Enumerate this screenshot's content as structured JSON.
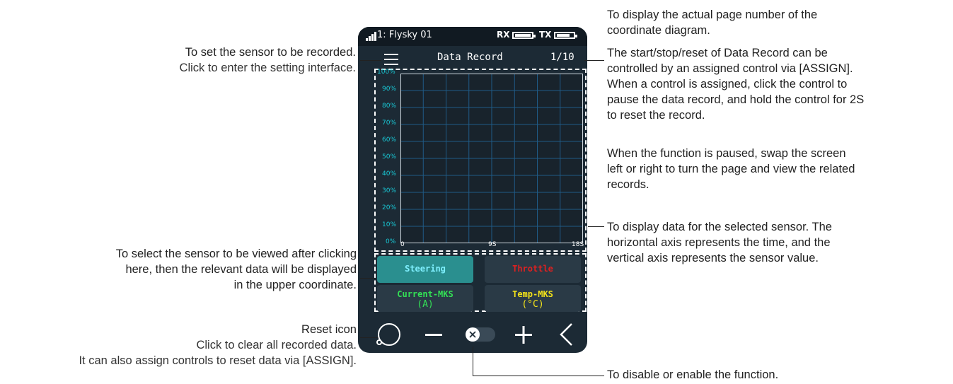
{
  "status_bar": {
    "model": "1: Flysky  01",
    "rx_label": "RX",
    "tx_label": "TX"
  },
  "screen": {
    "title": "Data Record",
    "page_indicator": "1/10"
  },
  "chart_data": {
    "type": "line",
    "y_ticks": [
      "100%",
      "90%",
      "80%",
      "70%",
      "60%",
      "50%",
      "40%",
      "30%",
      "20%",
      "10%",
      "0%"
    ],
    "x_ticks": [
      "0",
      "9S",
      "18S"
    ],
    "series": [],
    "grid": true
  },
  "sensors": [
    {
      "label": "Steering",
      "unit": "",
      "color": "#2ad0ff",
      "selected": true
    },
    {
      "label": "Throttle",
      "unit": "",
      "color": "#e02020",
      "selected": false
    },
    {
      "label": "Current-MKS",
      "unit": "(A)",
      "color": "#33e055",
      "selected": false
    },
    {
      "label": "Temp-MKS",
      "unit": "(°C)",
      "color": "#f2e21a",
      "selected": false
    }
  ],
  "toolbar": {
    "icons": [
      "reset-icon",
      "minus-icon",
      "toggle-switch",
      "plus-icon",
      "back-icon"
    ],
    "toggle_state": "off"
  },
  "annotations": {
    "page_number": [
      "To display the actual page number of the",
      "coordinate diagram."
    ],
    "assign": [
      "The start/stop/reset of Data Record can be",
      "controlled by an assigned control via [ASSIGN].",
      "When a control is assigned, click the control to",
      "pause the data record, and hold the control for 2S",
      "to reset the record."
    ],
    "paused": [
      "When the function is paused, swap the screen",
      "left or right to turn the page and view the related",
      "records."
    ],
    "sensor_setting": [
      "To set the sensor to be recorded.",
      "Click to enter the setting interface."
    ],
    "display_data": [
      "To display data for the selected sensor. The",
      "horizontal axis represents the time, and the",
      "vertical axis represents the sensor value."
    ],
    "select_sensor": [
      "To select the sensor to be viewed after clicking",
      "here, then the relevant data will be displayed",
      "in the upper coordinate."
    ],
    "reset_icon": [
      "Reset icon",
      "Click to clear all recorded data.",
      "It can also assign controls to reset data via [ASSIGN]."
    ],
    "toggle": [
      "To disable or enable the function."
    ]
  },
  "colors": {
    "device_bg": "#1c2a35",
    "chart_bg": "#18232c",
    "grid": "#1f5b86",
    "axis_tick": "#19c9d6",
    "selected_button": "#2a8f8f",
    "button_bg": "#2a3a46"
  }
}
